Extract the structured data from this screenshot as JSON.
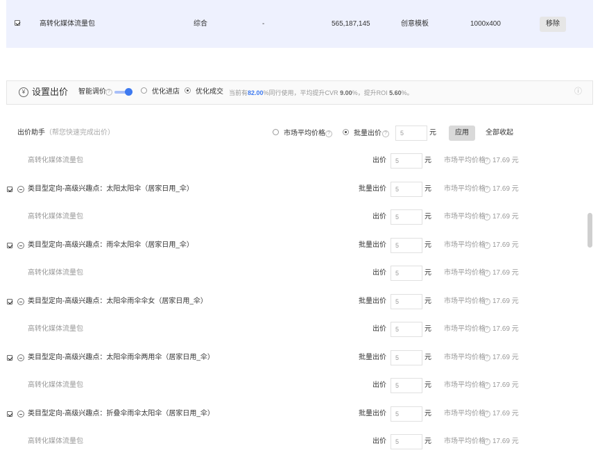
{
  "top_row": {
    "name": "高转化媒体流量包",
    "category": "综合",
    "dash": "-",
    "number": "565,187,145",
    "type": "创意模板",
    "size": "1000x400",
    "remove_label": "移除"
  },
  "panel": {
    "icon_glyph": "¥",
    "title": "设置出价",
    "smart_label": "智能调价",
    "help_glyph": "?",
    "opt_enter": "优化进店",
    "opt_deal": "优化成交",
    "summary_prefix": "当前有",
    "summary_percent": "82.00",
    "summary_mid": "%同行使用，平均提升CVR ",
    "summary_cvr": "9.00",
    "summary_mid2": "%，提升ROI ",
    "summary_roi": "5.60",
    "summary_suffix": "%。",
    "info_glyph": "ⓘ"
  },
  "assistant": {
    "label": "出价助手",
    "hint": "（帮您快速完成出价）",
    "market_label": "市场平均价格",
    "batch_label": "批量出价",
    "value": "5",
    "unit": "元",
    "apply_label": "应用",
    "collapse_label": "全部收起"
  },
  "rows": [
    {
      "kind": "media",
      "name": "高转化媒体流量包",
      "bid_label": "出价",
      "value": "5",
      "unit": "元",
      "market": "市场平均价格",
      "price": "17.69 元"
    },
    {
      "kind": "target",
      "name": "类目型定向-高级兴趣点：太阳太阳伞（居家日用_伞）",
      "bid_label": "批量出价",
      "value": "5",
      "unit": "元",
      "market": "市场平均价格",
      "price": "17.69 元"
    },
    {
      "kind": "media",
      "name": "高转化媒体流量包",
      "bid_label": "出价",
      "value": "5",
      "unit": "元",
      "market": "市场平均价格",
      "price": "17.69 元"
    },
    {
      "kind": "target",
      "name": "类目型定向-高级兴趣点：雨伞太阳伞（居家日用_伞）",
      "bid_label": "批量出价",
      "value": "5",
      "unit": "元",
      "market": "市场平均价格",
      "price": "17.69 元"
    },
    {
      "kind": "media",
      "name": "高转化媒体流量包",
      "bid_label": "出价",
      "value": "5",
      "unit": "元",
      "market": "市场平均价格",
      "price": "17.69 元"
    },
    {
      "kind": "target",
      "name": "类目型定向-高级兴趣点：太阳伞雨伞伞女（居家日用_伞）",
      "bid_label": "批量出价",
      "value": "5",
      "unit": "元",
      "market": "市场平均价格",
      "price": "17.69 元"
    },
    {
      "kind": "media",
      "name": "高转化媒体流量包",
      "bid_label": "出价",
      "value": "5",
      "unit": "元",
      "market": "市场平均价格",
      "price": "17.69 元"
    },
    {
      "kind": "target",
      "name": "类目型定向-高级兴趣点：太阳伞雨伞两用伞（居家日用_伞）",
      "bid_label": "批量出价",
      "value": "5",
      "unit": "元",
      "market": "市场平均价格",
      "price": "17.69 元"
    },
    {
      "kind": "media",
      "name": "高转化媒体流量包",
      "bid_label": "出价",
      "value": "5",
      "unit": "元",
      "market": "市场平均价格",
      "price": "17.69 元"
    },
    {
      "kind": "target",
      "name": "类目型定向-高级兴趣点：折叠伞雨伞太阳伞（居家日用_伞）",
      "bid_label": "批量出价",
      "value": "5",
      "unit": "元",
      "market": "市场平均价格",
      "price": "17.69 元"
    },
    {
      "kind": "media",
      "name": "高转化媒体流量包",
      "bid_label": "出价",
      "value": "5",
      "unit": "元",
      "market": "市场平均价格",
      "price": "17.69 元"
    }
  ],
  "colors": {
    "accent": "#3d79f0",
    "highlight_row": "#eef1fe",
    "muted_text": "#999999"
  }
}
